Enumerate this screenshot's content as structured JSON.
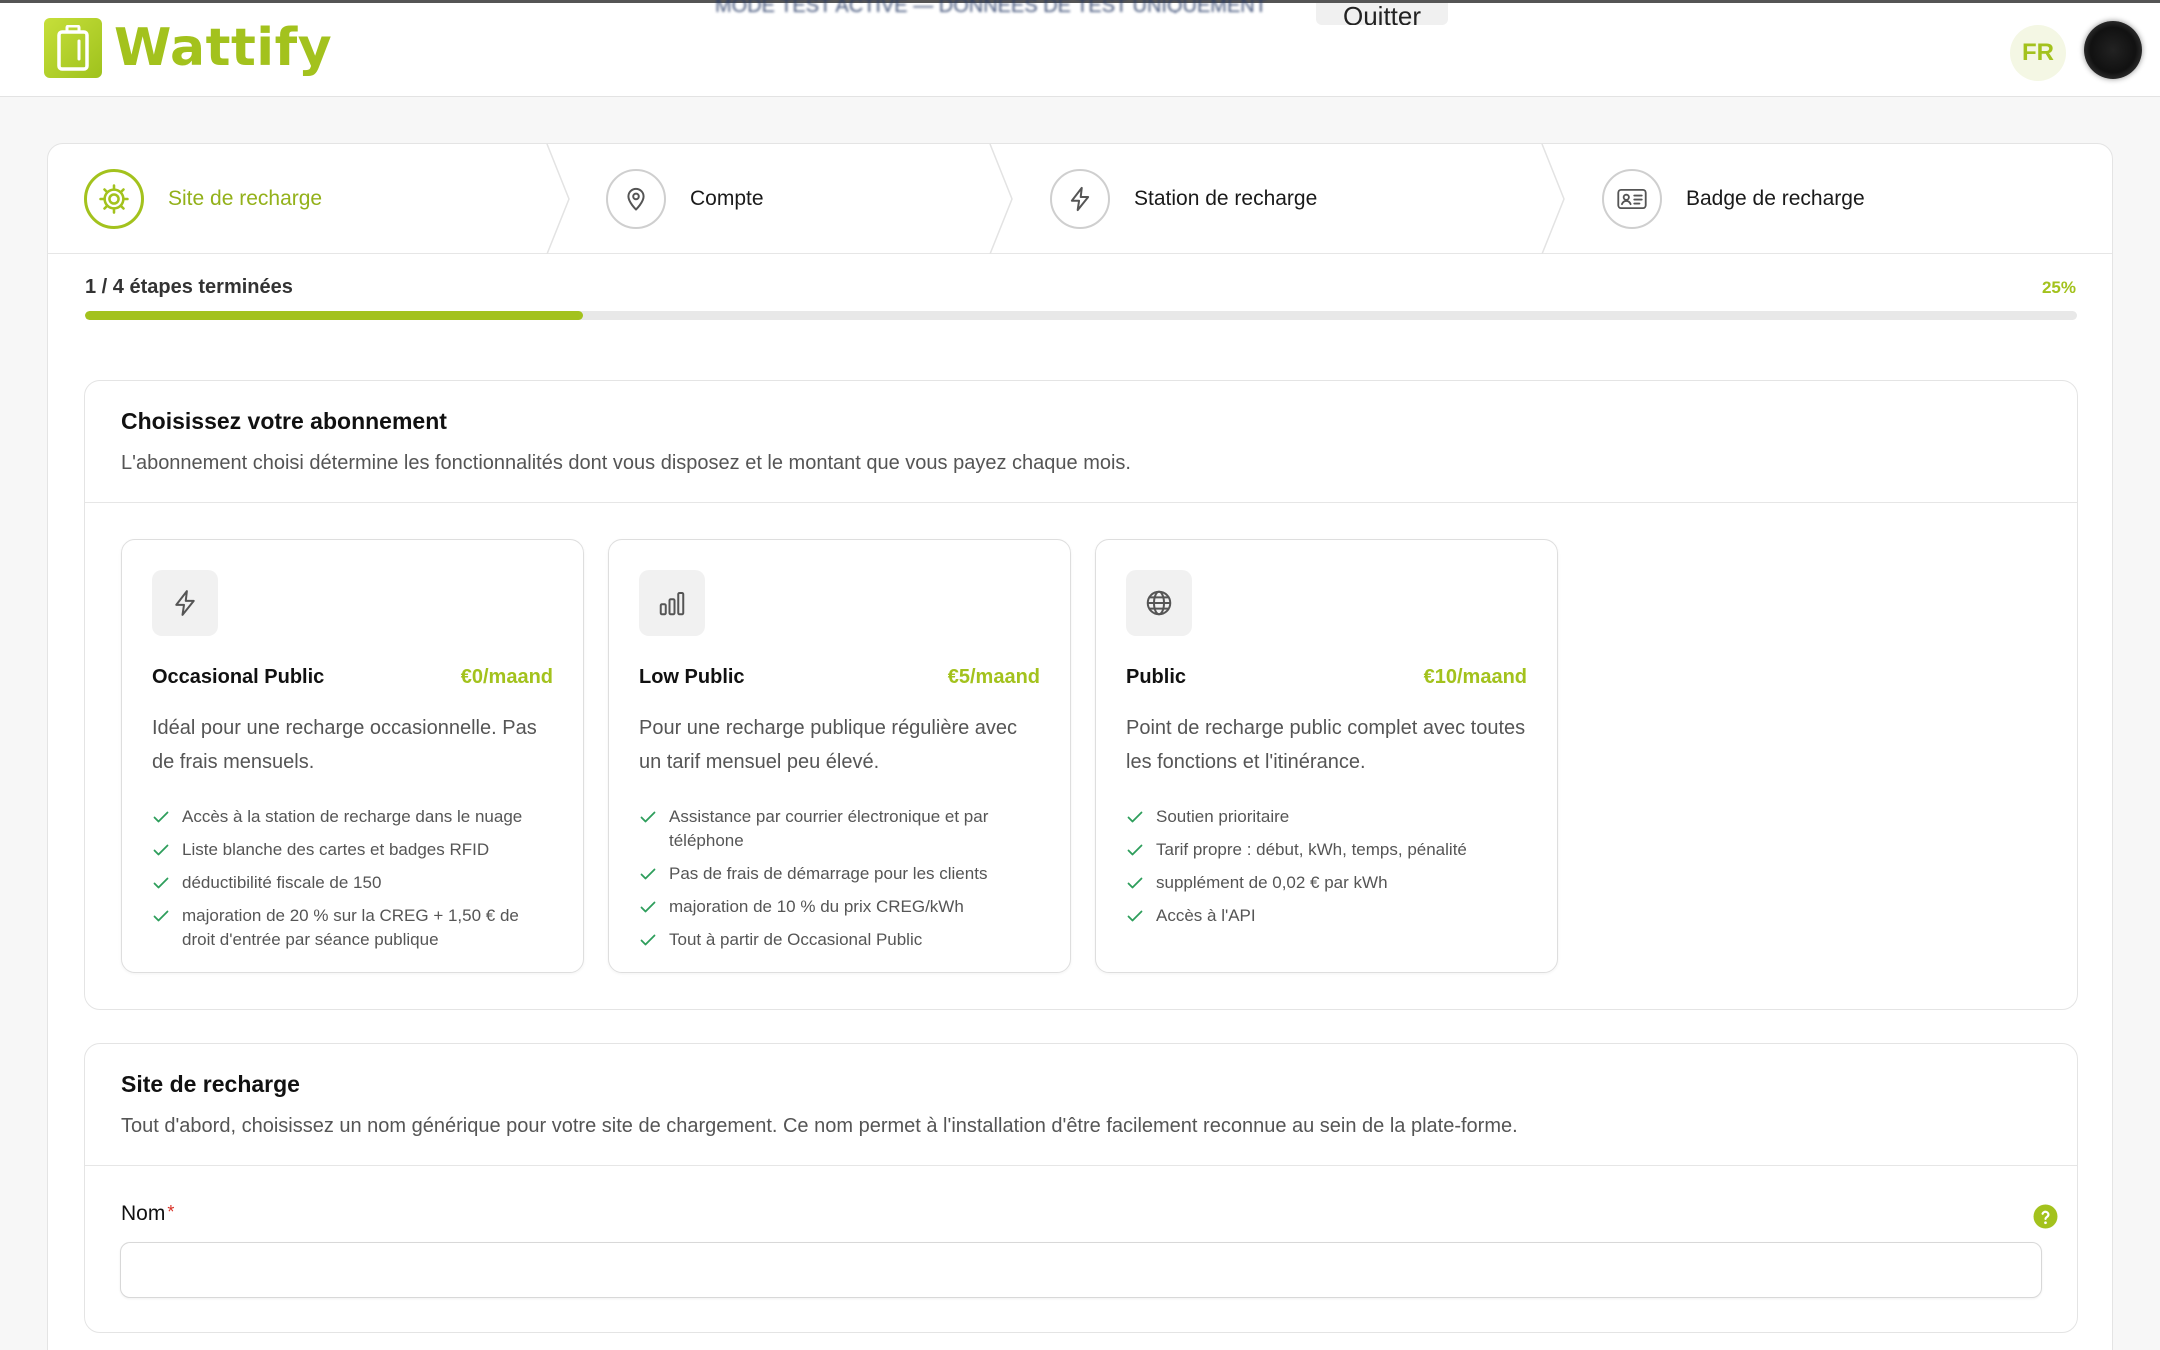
{
  "header": {
    "brand": "Wattify",
    "notice": "MODE TEST ACTIVÉ — DONNÉES DE TEST UNIQUEMENT",
    "quit_label": "Quitter",
    "language": "FR"
  },
  "stepper": {
    "steps": [
      {
        "label": "Site de recharge",
        "icon": "gear-icon",
        "active": true
      },
      {
        "label": "Compte",
        "icon": "map-pin-icon",
        "active": false
      },
      {
        "label": "Station de recharge",
        "icon": "lightning-icon",
        "active": false
      },
      {
        "label": "Badge de recharge",
        "icon": "id-card-icon",
        "active": false
      }
    ]
  },
  "progress": {
    "text": "1 / 4 étapes terminées",
    "percent_label": "25%",
    "fraction": 0.25
  },
  "subscription": {
    "title": "Choisissez votre abonnement",
    "description": "L'abonnement choisi détermine les fonctionnalités dont vous disposez et le montant que vous payez chaque mois.",
    "plans": [
      {
        "icon": "lightning-icon",
        "name": "Occasional Public",
        "price": "€0/maand",
        "description": "Idéal pour une recharge occasionnelle. Pas de frais mensuels.",
        "features": [
          "Accès à la station de recharge dans le nuage",
          "Liste blanche des cartes et badges RFID",
          "déductibilité fiscale de 150",
          "majoration de 20 % sur la CREG + 1,50 € de droit d'entrée par séance publique"
        ]
      },
      {
        "icon": "bar-chart-icon",
        "name": "Low Public",
        "price": "€5/maand",
        "description": "Pour une recharge publique régulière avec un tarif mensuel peu élevé.",
        "features": [
          "Assistance par courrier électronique et par téléphone",
          "Pas de frais de démarrage pour les clients",
          "majoration de 10 % du prix CREG/kWh",
          "Tout à partir de Occasional Public"
        ]
      },
      {
        "icon": "globe-icon",
        "name": "Public",
        "price": "€10/maand",
        "description": "Point de recharge public complet avec toutes les fonctions et l'itinérance.",
        "features": [
          "Soutien prioritaire",
          "Tarif propre : début, kWh, temps, pénalité",
          "supplément de 0,02 € par kWh",
          "Accès à l'API"
        ]
      }
    ]
  },
  "site": {
    "title": "Site de recharge",
    "description": "Tout d'abord, choisissez un nom générique pour votre site de chargement. Ce nom permet à l'installation d'être facilement reconnue au sein de la plate-forme.",
    "name_label": "Nom",
    "required_mark": "*",
    "name_value": "",
    "name_placeholder": ""
  },
  "colors": {
    "accent": "#a3c21d",
    "required": "#d93025"
  }
}
